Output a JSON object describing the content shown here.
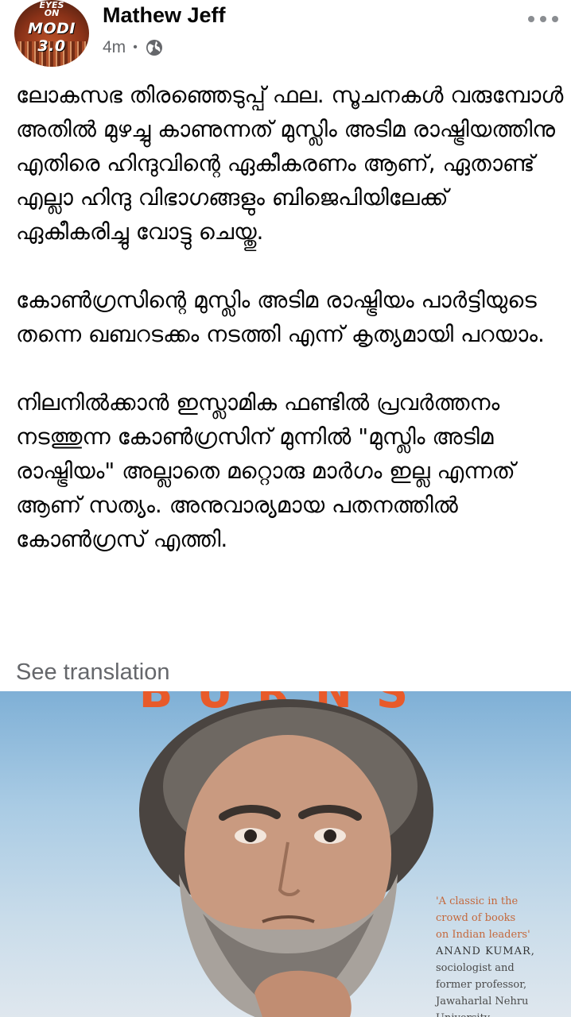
{
  "post": {
    "avatar_lines": [
      "EYES",
      "ON",
      "MODI 3.0"
    ],
    "author": "Mathew Jeff",
    "time": "4m",
    "audience_icon": "globe-icon",
    "more_icon": "more-dots-icon",
    "paragraphs": [
      "ലോകസഭ തിരഞ്ഞെടുപ്പ് ഫല. സൂചനകൾ വരുമ്പോൾ അതിൽ മുഴച്ചു കാണുന്നത് മുസ്ലിം അടിമ രാഷ്ട്രിയത്തിനു എതിരെ ഹിന്ദുവിന്റെ ഏകീകരണം ആണ്, ഏതാണ്ട് എല്ലാ ഹിന്ദു വിഭാഗങ്ങളും ബിജെപിയിലേക്ക് ഏകീകരിച്ചു വോട്ടു ചെയ്തു.",
      "കോൺഗ്രസിന്റെ മുസ്ലിം അടിമ രാഷ്ട്രിയം പാർട്ടിയുടെ തന്നെ ഖബറടക്കം നടത്തി എന്ന് കൃത്യമായി പറയാം.",
      "നിലനിൽക്കാൻ ഇസ്ലാമിക ഫണ്ടിൽ പ്രവർത്തനം നടത്തുന്ന കോൺഗ്രസിന് മുന്നിൽ \"മുസ്ലിം അടിമ രാഷ്ട്രിയം\" അല്ലാതെ മറ്റൊരു മാർഗം ഇല്ല എന്നത് ആണ് സത്യം. അനുവാര്യമായ പതനത്തിൽ കോൺഗ്രസ് എത്തി."
    ],
    "see_translation": "See translation"
  },
  "photo": {
    "cover_title_fragment": "BURNS",
    "quote_lines": [
      "'A classic in the",
      "crowd of books",
      "on Indian leaders'"
    ],
    "quote_author": "ANAND KUMAR,",
    "quote_role_lines": [
      "sociologist and",
      "former professor,",
      "Jawaharlal Nehru",
      "University"
    ]
  },
  "colors": {
    "text": "#050505",
    "secondary": "#65676b",
    "cover_title": "#e85a2a"
  }
}
